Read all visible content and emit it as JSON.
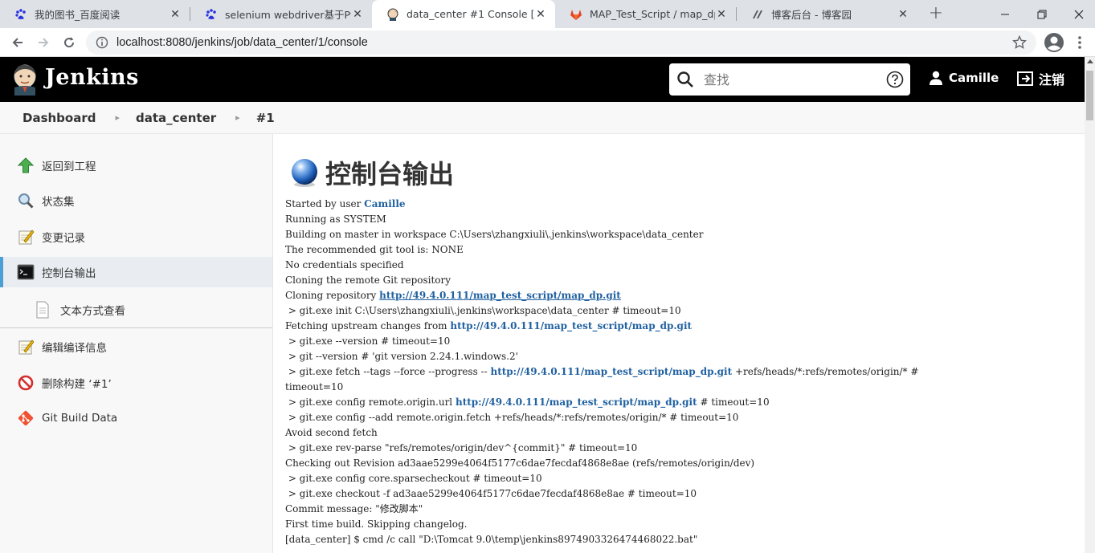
{
  "browser": {
    "tabs": [
      {
        "title": "我的图书_百度阅读",
        "icon": "baidu-paw-icon"
      },
      {
        "title": "selenium webdriver基于Pyth",
        "icon": "baidu-paw-icon"
      },
      {
        "title": "data_center #1 Console [Jen",
        "icon": "jenkins-icon"
      },
      {
        "title": "MAP_Test_Script / map_dp ·",
        "icon": "gitlab-icon"
      },
      {
        "title": "博客后台 - 博客园",
        "icon": "cnblogs-icon"
      }
    ],
    "url": "localhost:8080/jenkins/job/data_center/1/console"
  },
  "header": {
    "brand": "Jenkins",
    "search_placeholder": "查找",
    "user": "Camille",
    "logout": "注销"
  },
  "breadcrumb": [
    "Dashboard",
    "data_center",
    "#1"
  ],
  "sidebar": {
    "items": [
      {
        "label": "返回到工程",
        "icon": "up-arrow-icon"
      },
      {
        "label": "状态集",
        "icon": "magnifier-icon"
      },
      {
        "label": "变更记录",
        "icon": "notepad-icon"
      },
      {
        "label": "控制台输出",
        "icon": "terminal-icon"
      },
      {
        "label": "文本方式查看",
        "icon": "document-icon"
      },
      {
        "label": "编辑编译信息",
        "icon": "notepad-icon"
      },
      {
        "label": "删除构建 ‘#1’",
        "icon": "no-entry-icon"
      },
      {
        "label": "Git Build Data",
        "icon": "git-icon"
      }
    ]
  },
  "main": {
    "title": "控制台输出",
    "console": {
      "started_by": "Started by user ",
      "user_link": "Camille",
      "l2": "Running as SYSTEM",
      "l3": "Building on master in workspace C:\\Users\\zhangxiuli\\.jenkins\\workspace\\data_center",
      "l4": "The recommended git tool is: NONE",
      "l5": "No credentials specified",
      "l6": "Cloning the remote Git repository",
      "l7_pre": "Cloning repository ",
      "repo_url": "http://49.4.0.111/map_test_script/map_dp.git",
      "l8": " > git.exe init C:\\Users\\zhangxiuli\\.jenkins\\workspace\\data_center # timeout=10",
      "l9_pre": "Fetching upstream changes from ",
      "l10": " > git.exe --version # timeout=10",
      "l11": " > git --version # 'git version 2.24.1.windows.2'",
      "l12_pre": " > git.exe fetch --tags --force --progress -- ",
      "l12_post": " +refs/heads/*:refs/remotes/origin/* #",
      "l13": "timeout=10",
      "l14_pre": " > git.exe config remote.origin.url ",
      "l14_post": " # timeout=10",
      "l15": " > git.exe config --add remote.origin.fetch +refs/heads/*:refs/remotes/origin/* # timeout=10",
      "l16": "Avoid second fetch",
      "l17": " > git.exe rev-parse \"refs/remotes/origin/dev^{commit}\" # timeout=10",
      "l18": "Checking out Revision ad3aae5299e4064f5177c6dae7fecdaf4868e8ae (refs/remotes/origin/dev)",
      "l19": " > git.exe config core.sparsecheckout # timeout=10",
      "l20": " > git.exe checkout -f ad3aae5299e4064f5177c6dae7fecdaf4868e8ae # timeout=10",
      "l21": "Commit message: \"修改脚本\"",
      "l22": "First time build. Skipping changelog.",
      "l23": "[data_center] $ cmd /c call \"D:\\Tomcat 9.0\\temp\\jenkins8974903326474468022.bat\""
    }
  }
}
